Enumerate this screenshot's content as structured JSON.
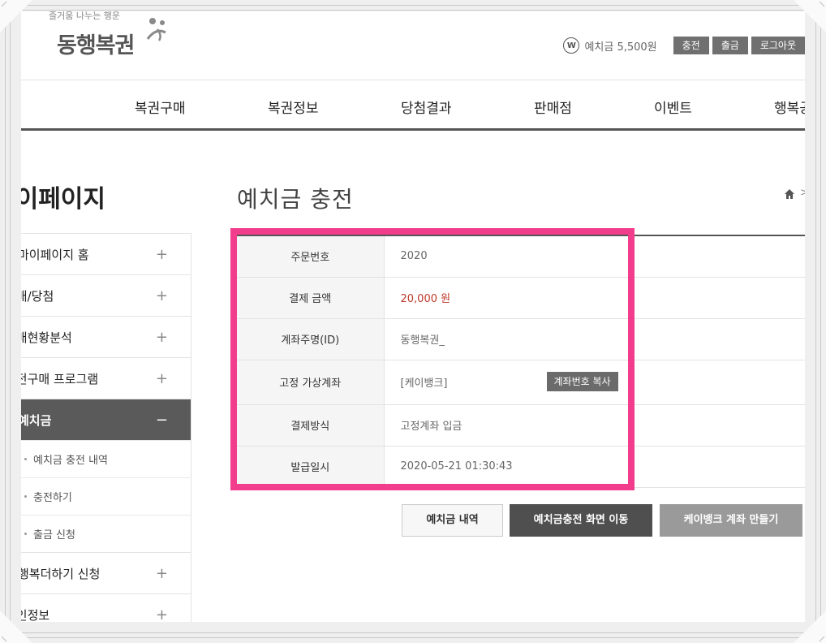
{
  "header": {
    "logo_sub": "즐거움 나누는 행운",
    "logo_main": "동행복권",
    "balance_icon": "W",
    "balance": "예치금 5,500원",
    "buttons": {
      "charge": "충전",
      "withdraw": "출금",
      "logout": "로그아웃"
    }
  },
  "nav": [
    "복권구매",
    "복권정보",
    "당첨결과",
    "판매점",
    "이벤트",
    "행복공감"
  ],
  "sidebar": {
    "title": "마이페이지",
    "items": [
      {
        "label": "마이페이지 홈",
        "sign": "+"
      },
      {
        "label": "구매/당첨",
        "sign": "+"
      },
      {
        "label": "구매현황분석",
        "sign": "+"
      },
      {
        "label": "건전구매 프로그램",
        "sign": "+"
      },
      {
        "label": "예치금",
        "sign": "−"
      }
    ],
    "subitems": [
      "예치금 충전 내역",
      "충전하기",
      "출금 신청"
    ],
    "items_after": [
      {
        "label": "행복더하기 신청",
        "sign": "+"
      },
      {
        "label": "개인정보",
        "sign": "+"
      }
    ]
  },
  "content": {
    "title": "예치금 충전",
    "rows": [
      {
        "label": "주문번호",
        "value": "2020"
      },
      {
        "label": "결제 금액",
        "value": "20,000 원"
      },
      {
        "label": "계좌주명(ID)",
        "value": "동행복권_"
      },
      {
        "label": "고정 가상계좌",
        "value": "[케이뱅크]",
        "button": "계좌번호 복사"
      },
      {
        "label": "결제방식",
        "value": "고정계좌 입금"
      },
      {
        "label": "발급일시",
        "value": "2020-05-21 01:30:43"
      }
    ],
    "buttons": {
      "history": "예치금 내역",
      "go_charge": "예치금충전 화면 이동",
      "kbank": "케이뱅크 계좌 만들기"
    }
  },
  "colors": {
    "highlight": "#f23c8c",
    "amount": "#c0392b",
    "active_menu": "#5a5a5a"
  }
}
